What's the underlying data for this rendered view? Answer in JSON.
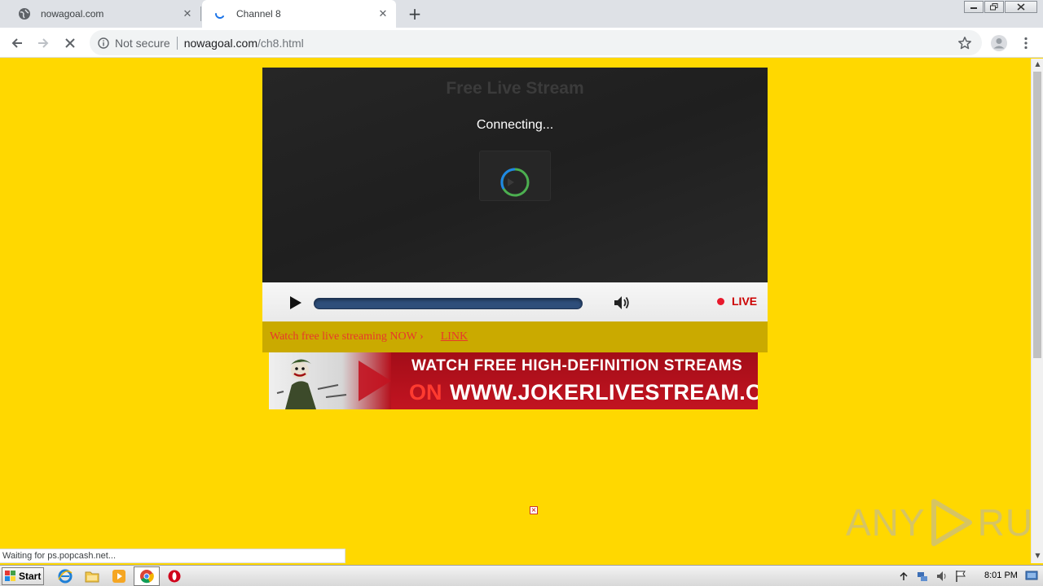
{
  "browser": {
    "tabs": [
      {
        "title": "nowagoal.com",
        "active": false
      },
      {
        "title": "Channel 8",
        "active": true
      }
    ],
    "address": {
      "security_label": "Not secure",
      "host": "nowagoal.com",
      "path": "/ch8.html"
    },
    "status_text": "Waiting for ps.popcash.net..."
  },
  "player": {
    "title": "Free Live Stream",
    "status": "Connecting...",
    "live_label": "LIVE"
  },
  "promo": {
    "text": "Watch free live streaming NOW ›",
    "link_label": "LINK"
  },
  "banner": {
    "line1": "WATCH FREE HIGH-DEFINITION STREAMS",
    "on": "ON",
    "url": "WWW.JOKERLIVESTREAM.COM"
  },
  "watermark": {
    "left": "ANY",
    "right": "RUN"
  },
  "taskbar": {
    "start_label": "Start",
    "clock": "8:01 PM"
  },
  "colors": {
    "page_background": "#FFD800",
    "promo_bar": "#CAAA00",
    "promo_text": "#E8372C",
    "live": "#CC0000"
  }
}
